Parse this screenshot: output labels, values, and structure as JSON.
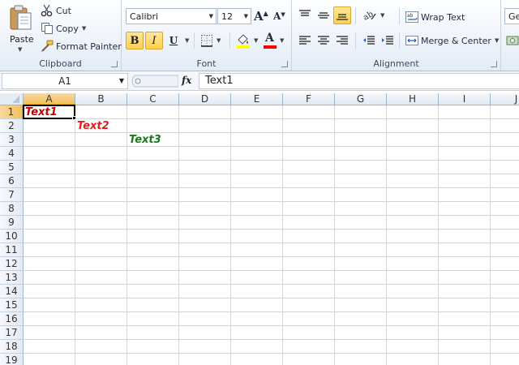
{
  "colors": {
    "text1": "#c00000",
    "text2": "#e02020",
    "text3": "#1a7a1a",
    "font_color_bar": "#ff0000",
    "highlight_bar": "#ffff00"
  },
  "ribbon": {
    "clipboard": {
      "paste": "Paste",
      "cut": "Cut",
      "copy": "Copy",
      "format_painter": "Format Painter",
      "label": "Clipboard"
    },
    "font": {
      "font_name": "Calibri",
      "font_size": "12",
      "bold": "B",
      "italic": "I",
      "underline": "U",
      "grow": "A",
      "shrink": "A",
      "font_color": "A",
      "label": "Font"
    },
    "alignment": {
      "wrap_text": "Wrap Text",
      "merge_center": "Merge & Center",
      "label": "Alignment"
    },
    "number": {
      "format_partial": "Ge"
    }
  },
  "formula_bar": {
    "name_box": "A1",
    "fx": "fx",
    "content": "Text1"
  },
  "grid": {
    "columns": [
      "A",
      "B",
      "C",
      "D",
      "E",
      "F",
      "G",
      "H",
      "I",
      "J"
    ],
    "rows": [
      "1",
      "2",
      "3",
      "4",
      "5",
      "6",
      "7",
      "8",
      "9",
      "10",
      "11",
      "12",
      "13",
      "14",
      "15",
      "16",
      "17",
      "18",
      "19"
    ],
    "cells": [
      {
        "ref": "A1",
        "value": "Text1"
      },
      {
        "ref": "B2",
        "value": "Text2"
      },
      {
        "ref": "C3",
        "value": "Text3"
      }
    ]
  }
}
